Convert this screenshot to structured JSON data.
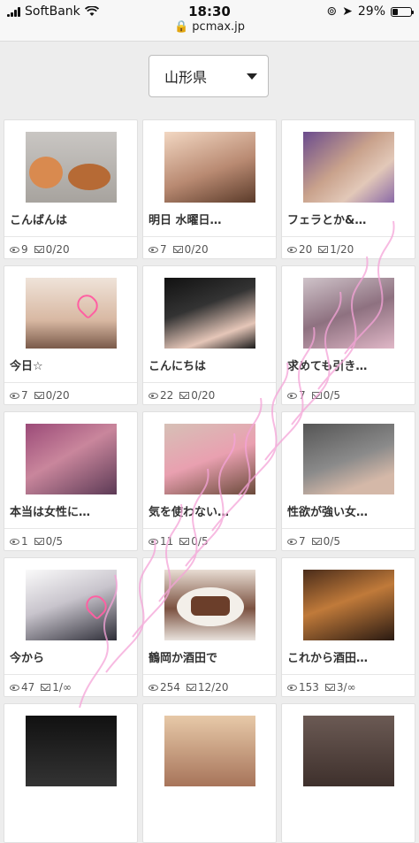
{
  "status_bar": {
    "carrier": "SoftBank",
    "time": "18:30",
    "url": "pcmax.jp",
    "battery": "29%",
    "battery_level": 0.29
  },
  "filter": {
    "prefecture": "山形県"
  },
  "cards": [
    {
      "title": "こんばんは",
      "views": "9",
      "messages": "0/20"
    },
    {
      "title": "明日 水曜日…",
      "views": "7",
      "messages": "0/20"
    },
    {
      "title": "フェラとか&…",
      "views": "20",
      "messages": "1/20"
    },
    {
      "title": "今日☆",
      "views": "7",
      "messages": "0/20"
    },
    {
      "title": "こんにちは",
      "views": "22",
      "messages": "0/20"
    },
    {
      "title": "求めても引き…",
      "views": "7",
      "messages": "0/5"
    },
    {
      "title": "本当は女性に…",
      "views": "1",
      "messages": "0/5"
    },
    {
      "title": "気を使わない…",
      "views": "11",
      "messages": "0/5"
    },
    {
      "title": "性欲が強い女…",
      "views": "7",
      "messages": "0/5"
    },
    {
      "title": "今から",
      "views": "47",
      "messages": "1/∞"
    },
    {
      "title": "鶴岡か酒田で",
      "views": "254",
      "messages": "12/20"
    },
    {
      "title": "これから酒田…",
      "views": "153",
      "messages": "3/∞"
    },
    {
      "title": "",
      "views": "",
      "messages": ""
    },
    {
      "title": "",
      "views": "",
      "messages": ""
    },
    {
      "title": "",
      "views": "",
      "messages": ""
    }
  ]
}
